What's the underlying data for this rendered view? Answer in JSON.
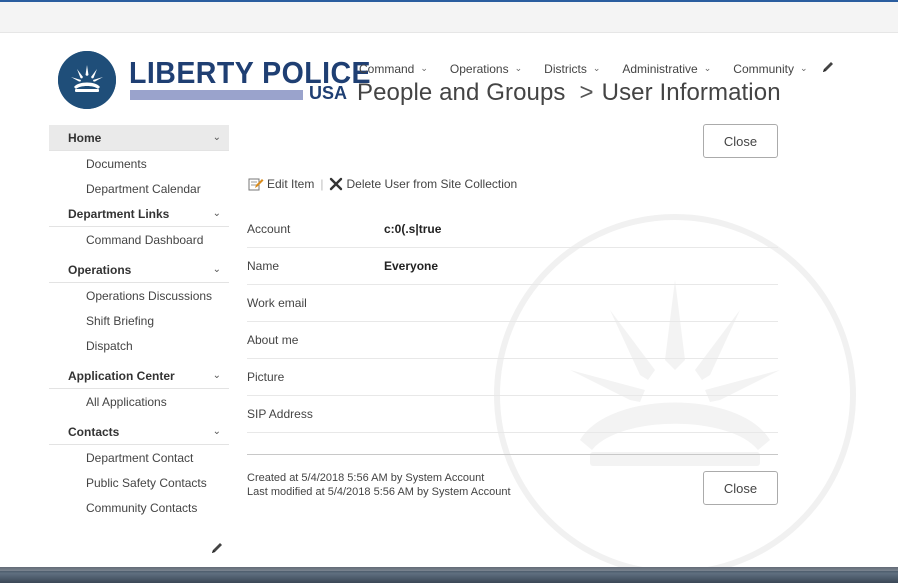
{
  "suite_bar": {
    "brand_color": "#2a5d9f"
  },
  "logo": {
    "text": "LIBERTY POLICE",
    "subtext": "USA"
  },
  "top_nav": {
    "items": [
      {
        "label": "Command"
      },
      {
        "label": "Operations"
      },
      {
        "label": "Districts"
      },
      {
        "label": "Administrative"
      },
      {
        "label": "Community"
      }
    ],
    "edit_icon": "pencil-icon"
  },
  "page_title": {
    "site": "People and Groups",
    "separator": ">",
    "page": "User Information"
  },
  "left_nav": {
    "sections": [
      {
        "label": "Home",
        "items": [
          "Documents",
          "Department Calendar"
        ]
      },
      {
        "label": "Department Links",
        "items": [
          "Command Dashboard"
        ]
      },
      {
        "label": "Operations",
        "items": [
          "Operations Discussions",
          "Shift Briefing",
          "Dispatch"
        ]
      },
      {
        "label": "Application Center",
        "items": [
          "All Applications"
        ]
      },
      {
        "label": "Contacts",
        "items": [
          "Department Contact",
          "Public Safety Contacts",
          "Community Contacts"
        ]
      }
    ],
    "edit_icon": "pencil-icon"
  },
  "toolbar": {
    "edit_label": "Edit Item",
    "separator": "|",
    "delete_label": "Delete User from Site Collection"
  },
  "buttons": {
    "close_label": "Close"
  },
  "fields": [
    {
      "label": "Account",
      "value": "c:0(.s|true"
    },
    {
      "label": "Name",
      "value": "Everyone"
    },
    {
      "label": "Work email",
      "value": ""
    },
    {
      "label": "About me",
      "value": ""
    },
    {
      "label": "Picture",
      "value": ""
    },
    {
      "label": "SIP Address",
      "value": ""
    }
  ],
  "footer": {
    "created": "Created at 5/4/2018 5:56 AM by System Account",
    "modified": "Last modified at 5/4/2018 5:56 AM by System Account"
  }
}
